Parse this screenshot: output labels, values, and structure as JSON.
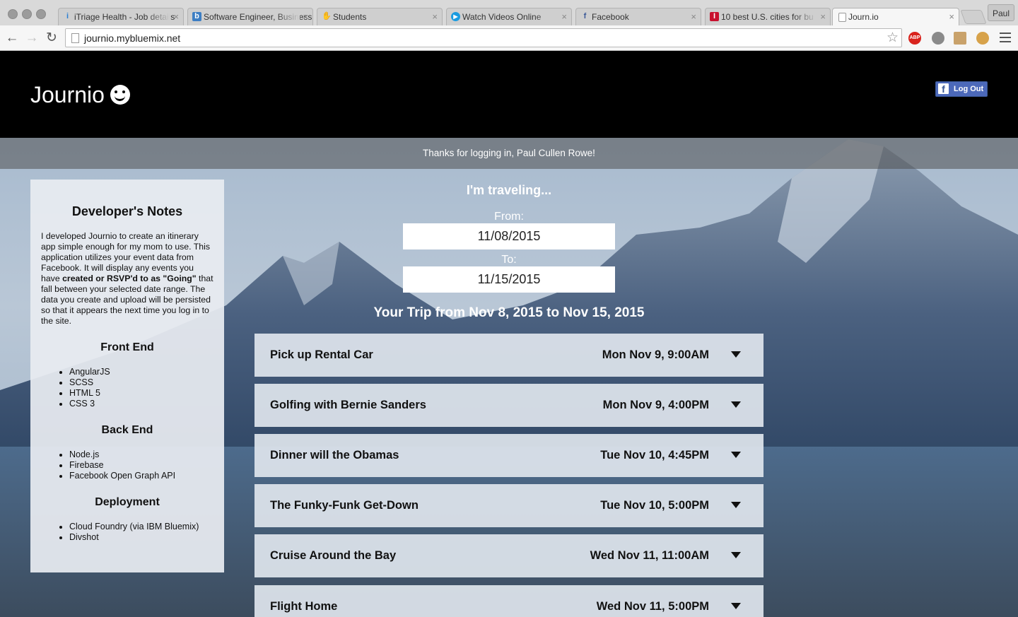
{
  "browser": {
    "tabs": [
      {
        "title": "iTriage Health - Job details",
        "icon": "itriage-icon"
      },
      {
        "title": "Software Engineer, Business",
        "icon": "b-icon"
      },
      {
        "title": "Students",
        "icon": "hand-icon"
      },
      {
        "title": "Watch Videos Online",
        "icon": "play-icon"
      },
      {
        "title": "Facebook",
        "icon": "facebook-icon"
      },
      {
        "title": "10 best U.S. cities for bu",
        "icon": "news-icon"
      },
      {
        "title": "Journ.io",
        "icon": "page-icon"
      }
    ],
    "profile_name": "Paul",
    "url": "journio.mybluemix.net",
    "extensions": [
      {
        "name": "adblock-icon",
        "label": "ABP",
        "color": "#d9231d"
      },
      {
        "name": "extension-grey-icon",
        "label": "",
        "color": "#8a8a8a"
      },
      {
        "name": "extension-box-icon",
        "label": "",
        "color": "#c9a26b"
      },
      {
        "name": "cookie-icon",
        "label": "",
        "color": "#d7a24a"
      }
    ]
  },
  "header": {
    "logo_text": "Journio",
    "logout_label": "Log Out"
  },
  "banner": {
    "message": "Thanks for logging in, Paul Cullen Rowe!"
  },
  "notes": {
    "title": "Developer's Notes",
    "intro_1": "I developed Journio to create an itinerary app simple enough for my mom to use. This application utilizes your event data from Facebook. It will display any events you have ",
    "intro_bold": "created or RSVP'd to as \"Going\"",
    "intro_2": " that fall between your selected date range. The data you create and upload will be persisted so that it appears the next time you log in to the site.",
    "sections": [
      {
        "heading": "Front End",
        "items": [
          "AngularJS",
          "SCSS",
          "HTML 5",
          "CSS 3"
        ]
      },
      {
        "heading": "Back End",
        "items": [
          "Node.js",
          "Firebase",
          "Facebook Open Graph API"
        ]
      },
      {
        "heading": "Deployment",
        "items": [
          "Cloud Foundry (via IBM Bluemix)",
          "Divshot"
        ]
      }
    ]
  },
  "form": {
    "heading": "I'm traveling...",
    "from_label": "From:",
    "from_value": "11/08/2015",
    "to_label": "To:",
    "to_value": "11/15/2015"
  },
  "trip": {
    "title": "Your Trip from Nov 8, 2015 to Nov 15, 2015",
    "events": [
      {
        "title": "Pick up Rental Car",
        "time": "Mon Nov 9, 9:00AM"
      },
      {
        "title": "Golfing with Bernie Sanders",
        "time": "Mon Nov 9, 4:00PM"
      },
      {
        "title": "Dinner will the Obamas",
        "time": "Tue Nov 10, 4:45PM"
      },
      {
        "title": "The Funky-Funk Get-Down",
        "time": "Tue Nov 10, 5:00PM"
      },
      {
        "title": "Cruise Around the Bay",
        "time": "Wed Nov 11, 11:00AM"
      },
      {
        "title": "Flight Home",
        "time": "Wed Nov 11, 5:00PM"
      }
    ]
  }
}
